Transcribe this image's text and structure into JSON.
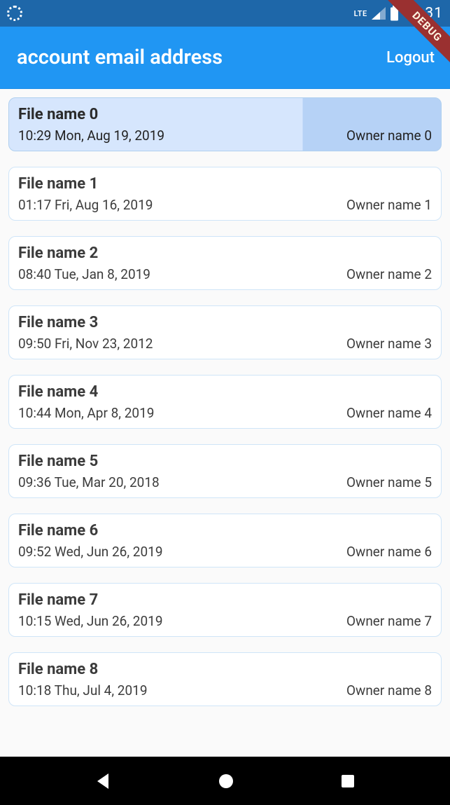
{
  "status_bar": {
    "network_label": "LTE",
    "clock": "11:31"
  },
  "debug_banner": "DEBUG",
  "app_bar": {
    "title": "account email address",
    "logout_label": "Logout"
  },
  "files": [
    {
      "name": "File name 0",
      "timestamp": "10:29 Mon, Aug 19, 2019",
      "owner": "Owner name 0",
      "selected": true
    },
    {
      "name": "File name 1",
      "timestamp": "01:17 Fri, Aug 16, 2019",
      "owner": "Owner name 1",
      "selected": false
    },
    {
      "name": "File name 2",
      "timestamp": "08:40 Tue, Jan 8, 2019",
      "owner": "Owner name 2",
      "selected": false
    },
    {
      "name": "File name 3",
      "timestamp": "09:50 Fri, Nov 23, 2012",
      "owner": "Owner name 3",
      "selected": false
    },
    {
      "name": "File name 4",
      "timestamp": "10:44 Mon, Apr 8, 2019",
      "owner": "Owner name 4",
      "selected": false
    },
    {
      "name": "File name 5",
      "timestamp": "09:36 Tue, Mar 20, 2018",
      "owner": "Owner name 5",
      "selected": false
    },
    {
      "name": "File name 6",
      "timestamp": "09:52 Wed, Jun 26, 2019",
      "owner": "Owner name 6",
      "selected": false
    },
    {
      "name": "File name 7",
      "timestamp": "10:15 Wed, Jun 26, 2019",
      "owner": "Owner name 7",
      "selected": false
    },
    {
      "name": "File name 8",
      "timestamp": "10:18 Thu, Jul 4, 2019",
      "owner": "Owner name 8",
      "selected": false
    }
  ]
}
